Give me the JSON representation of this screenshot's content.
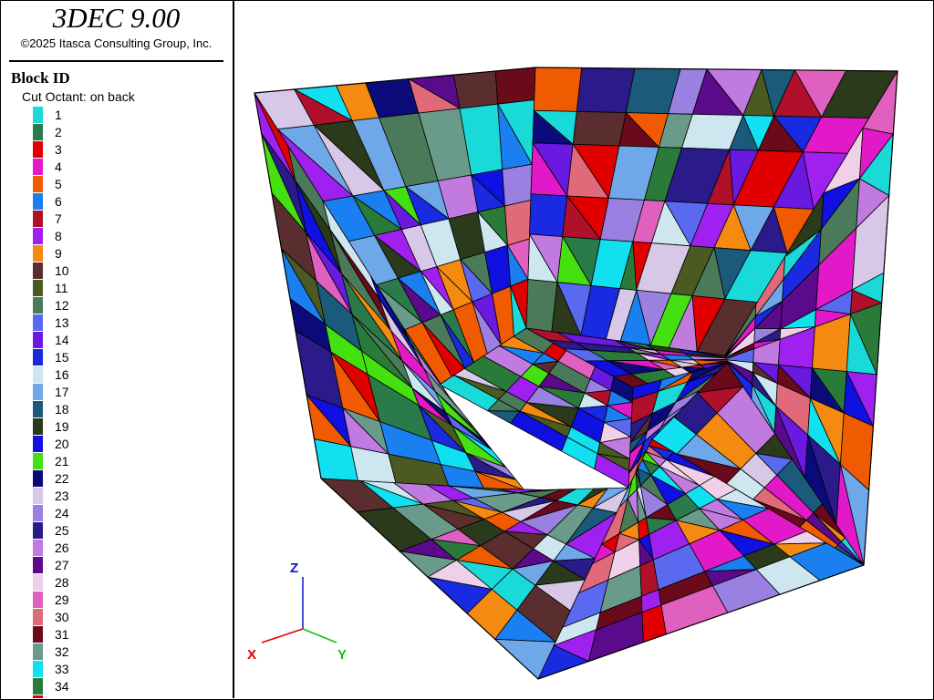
{
  "header": {
    "app_title": "3DEC 9.00",
    "copyright": "©2025 Itasca Consulting Group, Inc."
  },
  "legend": {
    "title": "Block  ID",
    "subtitle": "Cut Octant: on back",
    "items": [
      {
        "label": "1",
        "color": "#19d9d9"
      },
      {
        "label": "2",
        "color": "#2a7a4a"
      },
      {
        "label": "3",
        "color": "#e00000"
      },
      {
        "label": "4",
        "color": "#e219c8"
      },
      {
        "label": "5",
        "color": "#f05a00"
      },
      {
        "label": "6",
        "color": "#1a7ff0"
      },
      {
        "label": "7",
        "color": "#b0102a"
      },
      {
        "label": "8",
        "color": "#a020f0"
      },
      {
        "label": "9",
        "color": "#f58a10"
      },
      {
        "label": "10",
        "color": "#5a2e2e"
      },
      {
        "label": "11",
        "color": "#4a5a22"
      },
      {
        "label": "12",
        "color": "#4a7a5a"
      },
      {
        "label": "13",
        "color": "#5a6af0"
      },
      {
        "label": "14",
        "color": "#6a1ae0"
      },
      {
        "label": "15",
        "color": "#1a2ae0"
      },
      {
        "label": "16",
        "color": "#cde6f0"
      },
      {
        "label": "17",
        "color": "#6fa8e8"
      },
      {
        "label": "18",
        "color": "#1a5a7a"
      },
      {
        "label": "19",
        "color": "#2a3a1a"
      },
      {
        "label": "20",
        "color": "#1010e0"
      },
      {
        "label": "21",
        "color": "#44e010"
      },
      {
        "label": "22",
        "color": "#0a0a7a"
      },
      {
        "label": "23",
        "color": "#d8c8e8"
      },
      {
        "label": "24",
        "color": "#9a80e0"
      },
      {
        "label": "25",
        "color": "#2a1a8a"
      },
      {
        "label": "26",
        "color": "#c07ae0"
      },
      {
        "label": "27",
        "color": "#5a0a8a"
      },
      {
        "label": "28",
        "color": "#f0d0e8"
      },
      {
        "label": "29",
        "color": "#e060c0"
      },
      {
        "label": "30",
        "color": "#e06a7a"
      },
      {
        "label": "31",
        "color": "#6a0a1a"
      },
      {
        "label": "32",
        "color": "#6a9a8a"
      },
      {
        "label": "33",
        "color": "#10e0f0"
      },
      {
        "label": "34",
        "color": "#2a7a3a"
      }
    ]
  },
  "axes": {
    "x_label": "X",
    "y_label": "Y",
    "z_label": "Z",
    "x_color": "#e00000",
    "y_color": "#10c010",
    "z_color": "#1010d0"
  },
  "model": {
    "edge_color": "#000000"
  }
}
